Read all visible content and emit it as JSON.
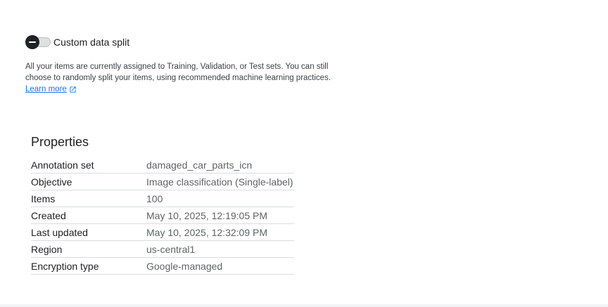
{
  "split": {
    "toggle_on": false,
    "label": "Custom data split",
    "description": "All your items are currently assigned to Training, Validation, or Test sets. You can still choose to randomly split your items, using recommended machine learning practices.",
    "learn_more": "Learn more"
  },
  "properties": {
    "title": "Properties",
    "rows": [
      {
        "key": "Annotation set",
        "value": "damaged_car_parts_icn"
      },
      {
        "key": "Objective",
        "value": "Image classification (Single-label)"
      },
      {
        "key": "Items",
        "value": "100"
      },
      {
        "key": "Created",
        "value": "May 10, 2025, 12:19:05 PM"
      },
      {
        "key": "Last updated",
        "value": "May 10, 2025, 12:32:09 PM"
      },
      {
        "key": "Region",
        "value": "us-central1"
      },
      {
        "key": "Encryption type",
        "value": "Google-managed"
      }
    ]
  },
  "icons": {
    "toggle": "toggle-off-icon",
    "external_link": "open-in-new-icon"
  },
  "colors": {
    "link": "#1a73e8",
    "text_primary": "#202124",
    "text_secondary": "#5f6368",
    "divider": "#dadce0"
  }
}
